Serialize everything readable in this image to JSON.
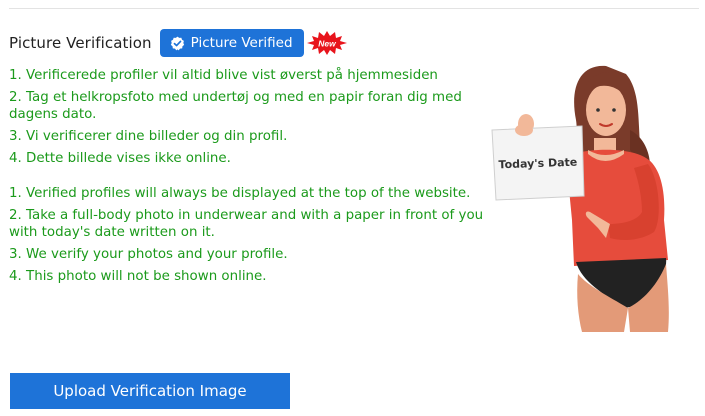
{
  "header": {
    "title": "Picture Verification",
    "verified_label": "Picture Verified",
    "new_badge": "New"
  },
  "norwegian": {
    "items": [
      "1. Verificerede profiler vil altid blive vist øverst på hjemmesiden",
      "2. Tag et helkropsfoto med undertøj og med en papir foran dig med dagens dato.",
      "3. Vi verificerer dine billeder og din profil.",
      "4. Dette billede vises ikke online."
    ]
  },
  "english": {
    "items": [
      "1. Verified profiles will always be displayed at the top of the website.",
      "2. Take a full-body photo in underwear and with a paper in front of you with today's date written on it.",
      "3. We verify your photos and your profile.",
      "4. This photo will not be shown online."
    ]
  },
  "illustration": {
    "sign_text": "Today's Date",
    "icon": "woman-holding-sign-illustration"
  },
  "actions": {
    "upload_label": "Upload Verification Image"
  },
  "colors": {
    "primary": "#1e73d8",
    "list_text": "#1b9a1b",
    "badge_red": "#e8141c"
  }
}
